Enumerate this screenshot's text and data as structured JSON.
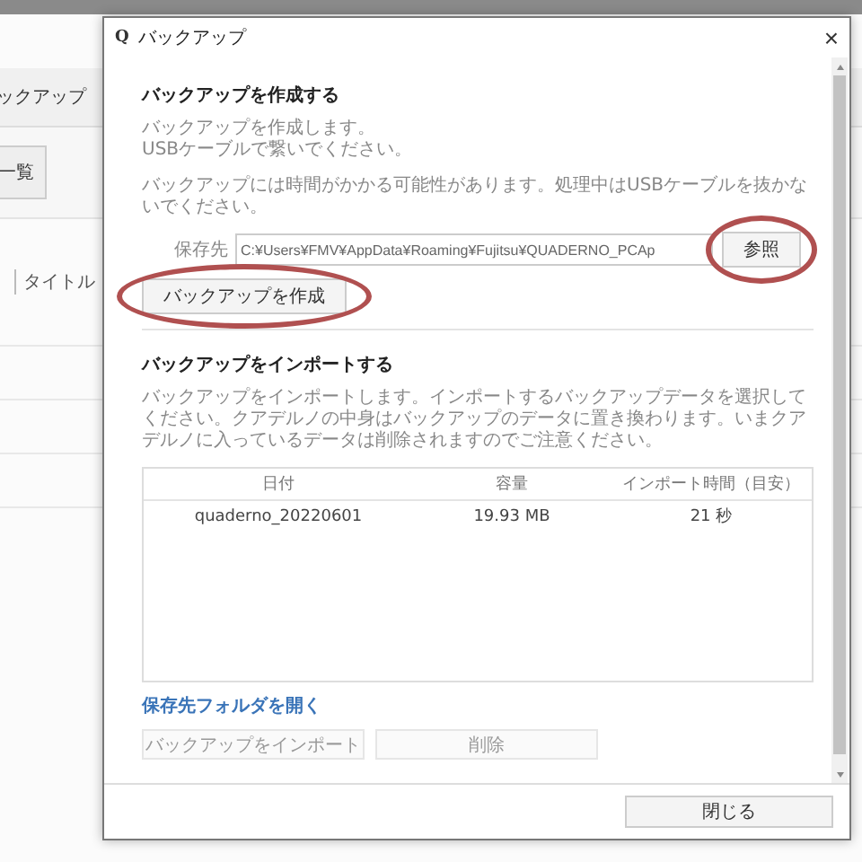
{
  "background_app": {
    "tab": "ックアップ",
    "button": "一覧",
    "column_header": "タイトル"
  },
  "dialog": {
    "icon": "Q",
    "title": "バックアップ",
    "close": "×",
    "create_section": {
      "title": "バックアップを作成する",
      "description": "バックアップを作成します。\nUSBケーブルで繋いでください。",
      "warning": "バックアップには時間がかかる可能性があります。処理中はUSBケーブルを抜かないでください。",
      "path_label": "保存先",
      "path_value": "C:¥Users¥FMV¥AppData¥Roaming¥Fujitsu¥QUADERNO_PCAp",
      "browse_button": {
        "label": "参照",
        "circled": true
      },
      "create_button": {
        "label": "バックアップを作成",
        "circled": true
      }
    },
    "import_section": {
      "title": "バックアップをインポートする",
      "description": "バックアップをインポートします。インポートするバックアップデータを選択してください。クアデルノの中身はバックアップのデータに置き換わります。いまクアデルノに入っているデータは削除されますのでご注意ください。",
      "table": {
        "columns": [
          "日付",
          "容量",
          "インポート時間（目安）"
        ],
        "rows": [
          {
            "cells": [
              "quaderno_20220601",
              "19.93 MB",
              "21 秒"
            ]
          }
        ]
      },
      "link": "保存先フォルダを開く",
      "buttons": [
        {
          "label": "バックアップをインポート",
          "disabled": true
        },
        {
          "label": "削除",
          "disabled": true
        }
      ]
    },
    "footer_button": "閉じる"
  }
}
